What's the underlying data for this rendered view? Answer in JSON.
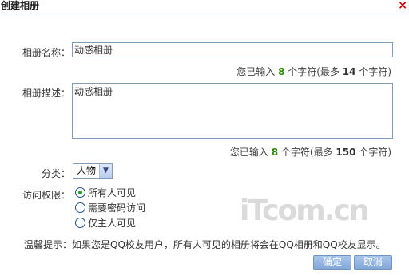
{
  "dialog": {
    "title": "创建相册",
    "close_glyph": "×"
  },
  "name_field": {
    "label": "相册名称：",
    "value": "动感相册",
    "counter": {
      "prefix": "您已输入",
      "count": "8",
      "middle": "个字符(最多",
      "max": "14",
      "suffix": "个字符)"
    }
  },
  "desc_field": {
    "label": "相册描述：",
    "value": "动感相册",
    "counter": {
      "prefix": "您已输入",
      "count": "8",
      "middle": "个字符(最多",
      "max": "150",
      "suffix": "个字符)"
    }
  },
  "category": {
    "label": "分类：",
    "selected": "人物",
    "arrow_icon": "chevron-down-icon"
  },
  "access": {
    "label": "访问权限：",
    "options": [
      {
        "label": "所有人可见",
        "checked": true
      },
      {
        "label": "需要密码访问",
        "checked": false
      },
      {
        "label": "仅主人可见",
        "checked": false
      }
    ]
  },
  "tip": {
    "label": "温馨提示：",
    "text": "如果您是QQ校友用户，所有人可见的相册将会在QQ相册和QQ校友显示。"
  },
  "buttons": {
    "confirm": "确定",
    "cancel": "取消"
  },
  "watermark": "iTcom.cn",
  "colors": {
    "accent_green": "#2a8a00",
    "close_red": "#cc0000",
    "button_blue": "#8fb3e2",
    "input_border": "#7f9db9"
  }
}
